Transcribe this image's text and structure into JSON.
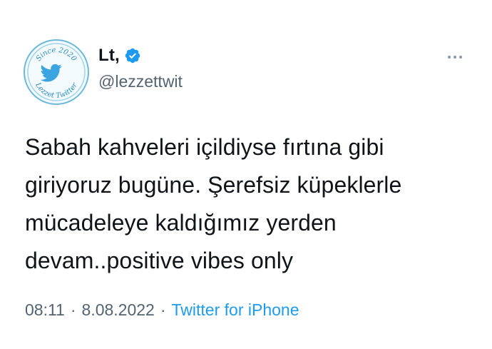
{
  "author": {
    "display_name": "Lt,",
    "handle": "@lezzettwit",
    "verified": true,
    "avatar": {
      "badge_top_text": "Since 2020",
      "badge_bottom_text": "Lezzet Twitter"
    }
  },
  "tweet": {
    "text": "Sabah kahveleri içildiyse fırtına gibi\ngiriyoruz bugüne. Şerefsiz küpeklerle\nmücadeleye kaldığımız yerden\ndevam..positive vibes only",
    "time": "08:11",
    "date": "8.08.2022",
    "separator": "·",
    "source": "Twitter for iPhone"
  },
  "colors": {
    "accent": "#1d9bf0",
    "secondary_text": "#536471",
    "primary_text": "#0f1419"
  },
  "icons": {
    "verified": "verified-badge-icon",
    "more": "more-options-icon",
    "avatar_bird": "twitter-bird-icon"
  }
}
